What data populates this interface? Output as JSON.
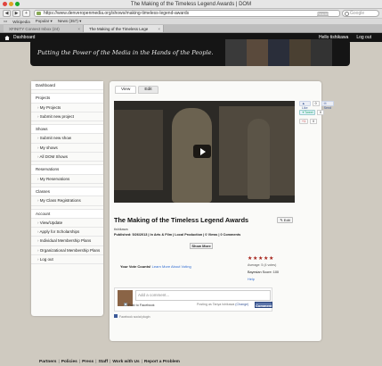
{
  "browser": {
    "window_title": "The Making of the Timeless Legend Awards | DOM",
    "url": "https://www.denveropenmedia.org/shows/making-timeless-legend-awards",
    "reader_label": "Reader",
    "search_placeholder": "Google",
    "bookmarks": [
      "Wikipedia",
      "Popular ▾",
      "News (357) ▾"
    ],
    "tabs": [
      {
        "label": "XFINITY Connect Inbox (24)"
      },
      {
        "label": "The Making of the Timeless Lege"
      }
    ]
  },
  "site": {
    "header_left": "Dashboard",
    "header_user": "Hello tishikawa",
    "logout": "Log out",
    "tagline": "Putting the Power of the Media in the Hands of the People."
  },
  "sidebar": {
    "items": [
      {
        "label": "Dashboard",
        "type": "head"
      },
      {
        "label": "Projects",
        "type": "head"
      },
      {
        "label": "My Projects",
        "type": "sub"
      },
      {
        "label": "Submit new project",
        "type": "sub"
      },
      {
        "label": "Shows",
        "type": "head"
      },
      {
        "label": "Submit new show",
        "type": "sub"
      },
      {
        "label": "My shows",
        "type": "sub"
      },
      {
        "label": "All DOM Shows",
        "type": "sub"
      },
      {
        "label": "Reservations",
        "type": "head"
      },
      {
        "label": "My Reservations",
        "type": "sub"
      },
      {
        "label": "Classes",
        "type": "head"
      },
      {
        "label": "My Class Registrations",
        "type": "sub"
      },
      {
        "label": "Account",
        "type": "head"
      },
      {
        "label": "View/Update",
        "type": "sub"
      },
      {
        "label": "Apply for Scholarships",
        "type": "sub"
      },
      {
        "label": "Individual Membership Plans",
        "type": "sub"
      },
      {
        "label": "Organizational Membership Plans",
        "type": "sub"
      },
      {
        "label": "Log out",
        "type": "sub"
      }
    ]
  },
  "main": {
    "tab_view": "View",
    "tab_edit": "Edit",
    "share": {
      "like": "Like",
      "like_count": "0",
      "send": "Send",
      "tweet": "Tweet",
      "tweet_count": "0",
      "gplus": "+1",
      "gplus_count": "0"
    },
    "title": "The Making of the Timeless Legend Awards",
    "edit_button": "Edit",
    "author": "tishikawa",
    "published": "Published: 5/26/2013 | In Arts & Film | Local Production | 0 Views | 0 Comments",
    "show_more": "Show More",
    "vote_text": "Your Vote Counts!",
    "vote_link": "Learn More About Voting",
    "rating": 5,
    "average": "Average: 5 (4 votes)",
    "bayesian": "Bayesian Score: 100",
    "help": "Help",
    "comment_placeholder": "Add a comment...",
    "post_to_facebook": "Post to Facebook",
    "posting_as": "Posting as Tanya Ishikawa",
    "change": "(Change)",
    "comment_button": "Comment",
    "fb_plugin": "Facebook social plugin"
  },
  "footer": {
    "links": [
      "Partners",
      "Policies",
      "Press",
      "Staff",
      "Work with Us",
      "Report a Problem"
    ]
  },
  "colors": {
    "page_bg": "#cfcac0",
    "header_bg": "#141414",
    "link": "#2e6ad0",
    "star": "#a52018",
    "facebook": "#3b5998"
  }
}
